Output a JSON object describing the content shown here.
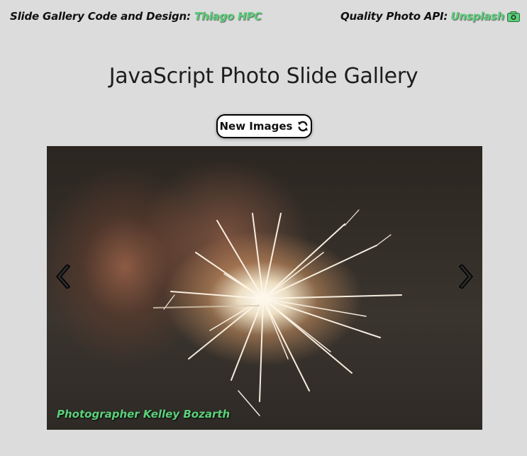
{
  "header": {
    "design_credit_label": "Slide Gallery Code and Design:",
    "design_credit_name": "Thiago HPC",
    "api_credit_label": "Quality Photo API:",
    "api_credit_name": "Unsplash",
    "api_icon": "camera-icon",
    "link_color": "#5bd07a"
  },
  "main": {
    "title": "JavaScript Photo Slide Gallery",
    "new_images_label": "New Images",
    "new_images_icon": "refresh-icon"
  },
  "slide": {
    "photographer_label": "Photographer Kelley Bozarth",
    "prev_icon": "chevron-left-icon",
    "next_icon": "chevron-right-icon"
  }
}
